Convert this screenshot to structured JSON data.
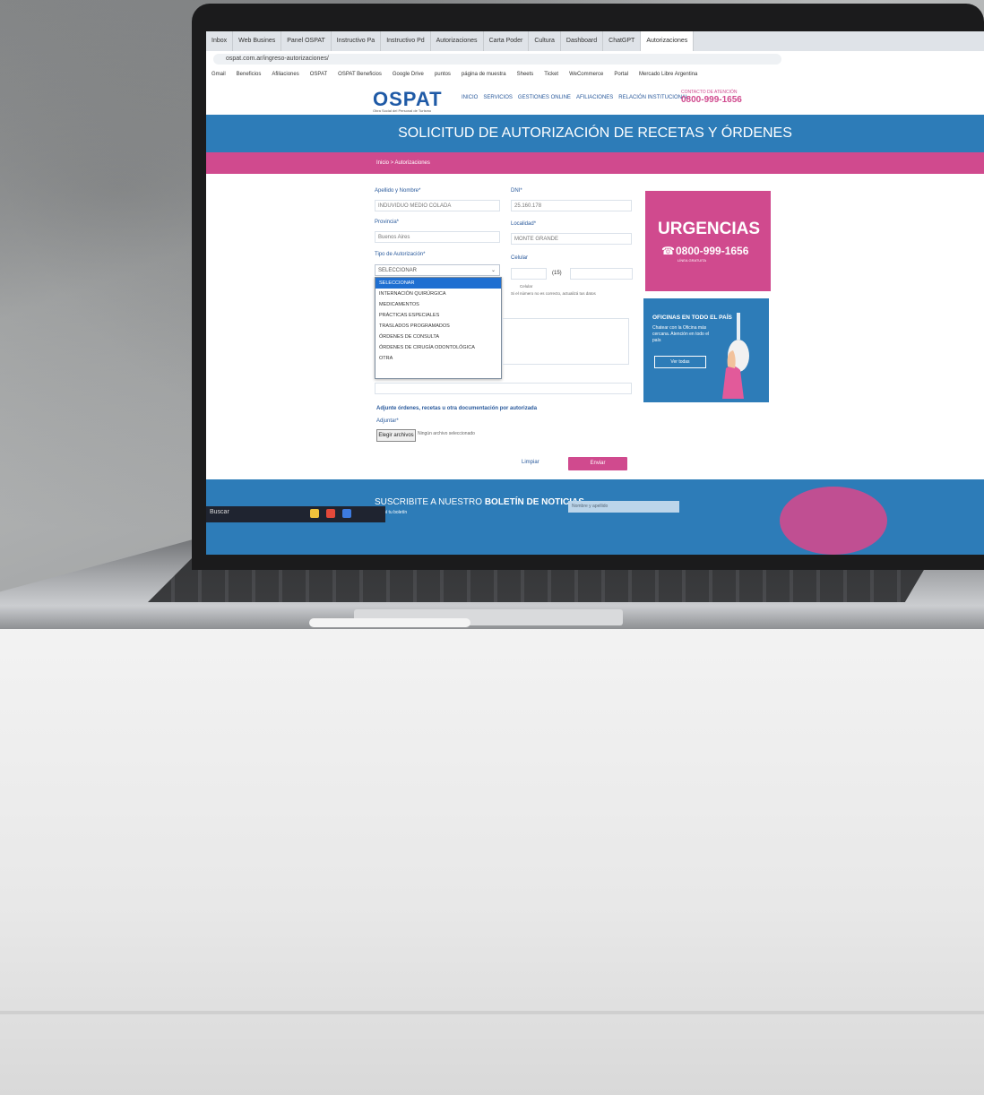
{
  "browser": {
    "tabs": [
      "Inbox",
      "Web Busines",
      "Panel OSPAT",
      "Instructivo Pa",
      "Instructivo Pd",
      "Autorizaciones",
      "Carta Poder",
      "Cultura",
      "Dashboard",
      "ChatGPT",
      "Autorizaciones"
    ],
    "url": "ospat.com.ar/ingreso-autorizaciones/",
    "bookmarks": [
      "Gmail",
      "Beneficios",
      "Afiliaciones",
      "OSPAT",
      "OSPAT Beneficios",
      "Google Drive",
      "puntos",
      "página de muestra",
      "Sheets",
      "Ticket",
      "WeCommerce",
      "Portal",
      "Mercado Libre Argentina"
    ]
  },
  "site": {
    "logo": "OSPAT",
    "logo_sub": "Obra Social del Personal de Turismo",
    "nav": [
      "INICIO",
      "SERVICIOS",
      "GESTIONES ONLINE",
      "AFILIACIONES",
      "RELACIÓN INSTITUCIONAL"
    ],
    "phone_label": "CONTACTO DE ATENCIÓN",
    "phone": "0800-999-1656",
    "hero_title": "SOLICITUD DE AUTORIZACIÓN DE RECETAS Y ÓRDENES",
    "breadcrumb": "Inicio > Autorizaciones"
  },
  "form": {
    "name_label": "Apellido y Nombre*",
    "name_value": "INDUVIDUO MEDIO COLADA",
    "dni_label": "DNI*",
    "dni_value": "25.160.178",
    "province_label": "Provincia*",
    "province_value": "Buenos Aires",
    "locality_label": "Localidad*",
    "locality_value": "MONTE GRANDE",
    "type_label": "Tipo de Autorización*",
    "type_value": "SELECCIONAR",
    "options": [
      "SELECCIONAR",
      "INTERNACIÓN QUIRÚRGICA",
      "MEDICAMENTOS",
      "PRÁCTICAS ESPECIALES",
      "TRASLADOS PROGRAMADOS",
      "ÓRDENES DE CONSULTA",
      "ÓRDENES DE CIRUGÍA ODONTOLÓGICA",
      "OTRA"
    ],
    "phone_label": "Celular",
    "phone_prefix": "(15)",
    "phone_note": "Celular",
    "phone_hint": "Si el número no es correcto, actualizá tus datos",
    "attach_hint": "Adjunte órdenes, recetas u otra documentación por autorizada",
    "file_label": "Adjuntar*",
    "file_button": "Elegir archivos",
    "file_none": "Ningún archivo seleccionado",
    "clear": "Limpiar",
    "send": "Enviar"
  },
  "cards": {
    "urgencias_title": "URGENCIAS",
    "urgencias_phone": "0800-999-1656",
    "urgencias_sub": "LÍNEA GRATUITA",
    "oficinas_title": "OFICINAS EN TODO EL PAÍS",
    "oficinas_text": "Chatear con la Oficina más cercana. Atención en todo el país",
    "oficinas_button": "Ver todas"
  },
  "newsletter": {
    "title_pre": "SUSCRIBITE A NUESTRO",
    "title_bold": "BOLETÍN DE NOTICIAS",
    "sub": "Recibí tu boletín",
    "input_placeholder": "Nombre y apellido"
  },
  "taskbar": {
    "search": "Buscar"
  },
  "colors": {
    "blue": "#2d7cb8",
    "magenta": "#d04a8e",
    "logo_blue": "#1f5aa6"
  }
}
